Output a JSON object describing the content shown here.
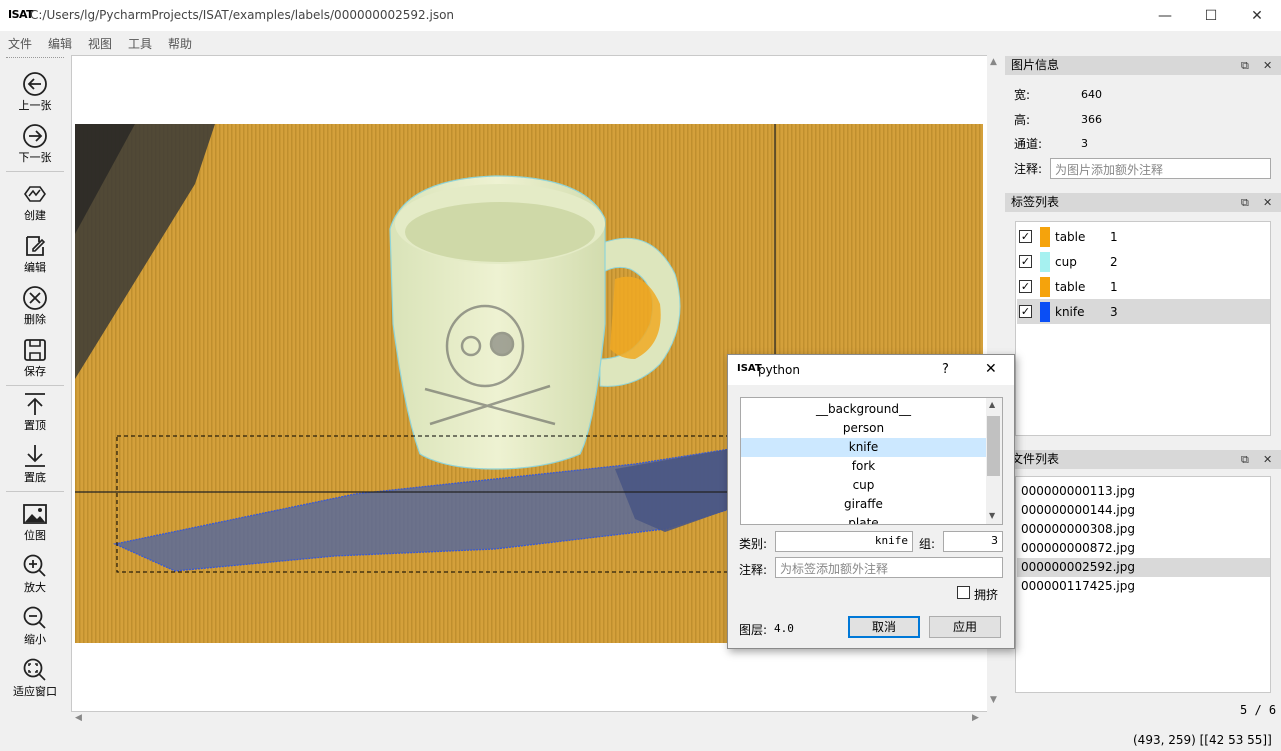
{
  "window": {
    "logo": "ISAT",
    "title": "C:/Users/lg/PycharmProjects/ISAT/examples/labels/000000002592.json",
    "minimize": "—",
    "maximize": "☐",
    "close": "✕"
  },
  "menu": [
    "文件",
    "编辑",
    "视图",
    "工具",
    "帮助"
  ],
  "toolbar": {
    "prev": "上一张",
    "next": "下一张",
    "create": "创建",
    "edit": "编辑",
    "delete": "删除",
    "save": "保存",
    "to_top": "置顶",
    "to_bottom": "置底",
    "bitmap": "位图",
    "zoom_in": "放大",
    "zoom_out": "缩小",
    "fit_window": "适应窗口"
  },
  "image_info": {
    "title": "图片信息",
    "width_label": "宽:",
    "width": "640",
    "height_label": "高:",
    "height": "366",
    "channels_label": "通道:",
    "channels": "3",
    "note_label": "注释:",
    "note_placeholder": "为图片添加额外注释"
  },
  "label_list": {
    "title": "标签列表",
    "items": [
      {
        "name": "table",
        "group": "1",
        "color": "#f5a30c",
        "checked": true
      },
      {
        "name": "cup",
        "group": "2",
        "color": "#a6f1f0",
        "checked": true
      },
      {
        "name": "table",
        "group": "1",
        "color": "#f5a30c",
        "checked": true
      },
      {
        "name": "knife",
        "group": "3",
        "color": "#0a4ef5",
        "checked": true
      }
    ]
  },
  "file_list": {
    "title": "文件列表",
    "files": [
      "000000000113.jpg",
      "000000000144.jpg",
      "000000000308.jpg",
      "000000000872.jpg",
      "000000002592.jpg",
      "000000117425.jpg"
    ],
    "selected": 4,
    "count": "5 / 6"
  },
  "status": "(493, 259) [[42 53 55]]",
  "dialog": {
    "logo": "ISAT",
    "title": "python",
    "help": "?",
    "close": "✕",
    "categories": [
      "__background__",
      "person",
      "knife",
      "fork",
      "cup",
      "giraffe",
      "plate"
    ],
    "selected": 2,
    "category_label": "类别:",
    "category_value": "knife",
    "group_label": "组:",
    "group_value": "3",
    "note_label": "注释:",
    "note_placeholder": "为标签添加额外注释",
    "crowd_label": "拥挤",
    "layer_label": "图层:",
    "layer_value": "4.0",
    "cancel": "取消",
    "apply": "应用"
  }
}
